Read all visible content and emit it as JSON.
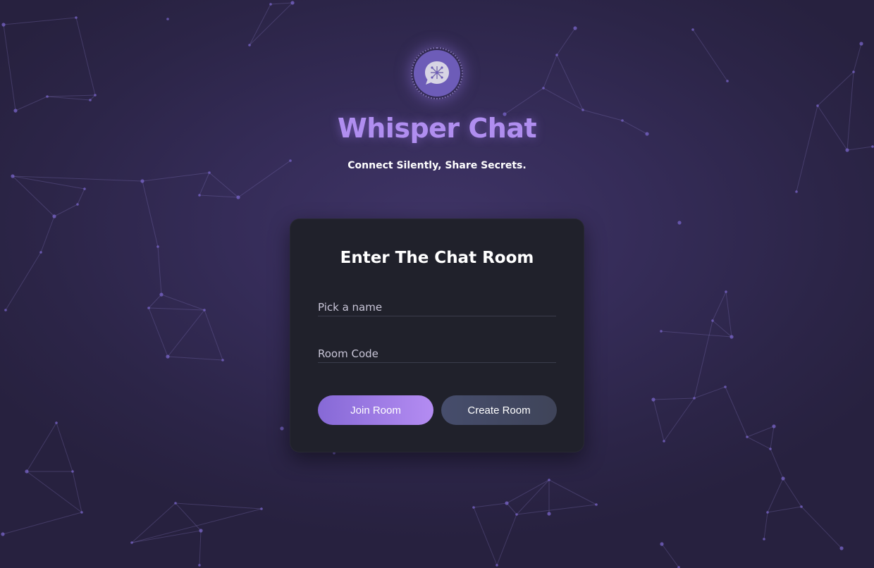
{
  "app": {
    "title": "Whisper Chat",
    "tagline": "Connect Silently, Share Secrets."
  },
  "logo": {
    "icon": "chat-bubble-icon"
  },
  "card": {
    "title": "Enter The Chat Room",
    "name_field": {
      "placeholder": "Pick a name",
      "value": ""
    },
    "room_field": {
      "placeholder": "Room Code",
      "value": ""
    },
    "join_label": "Join Room",
    "create_label": "Create Room"
  },
  "colors": {
    "accent": "#b08ef0",
    "join_start": "#8669d6",
    "join_end": "#b48cf2",
    "card_bg": "#20212b",
    "background": "#352c58"
  }
}
